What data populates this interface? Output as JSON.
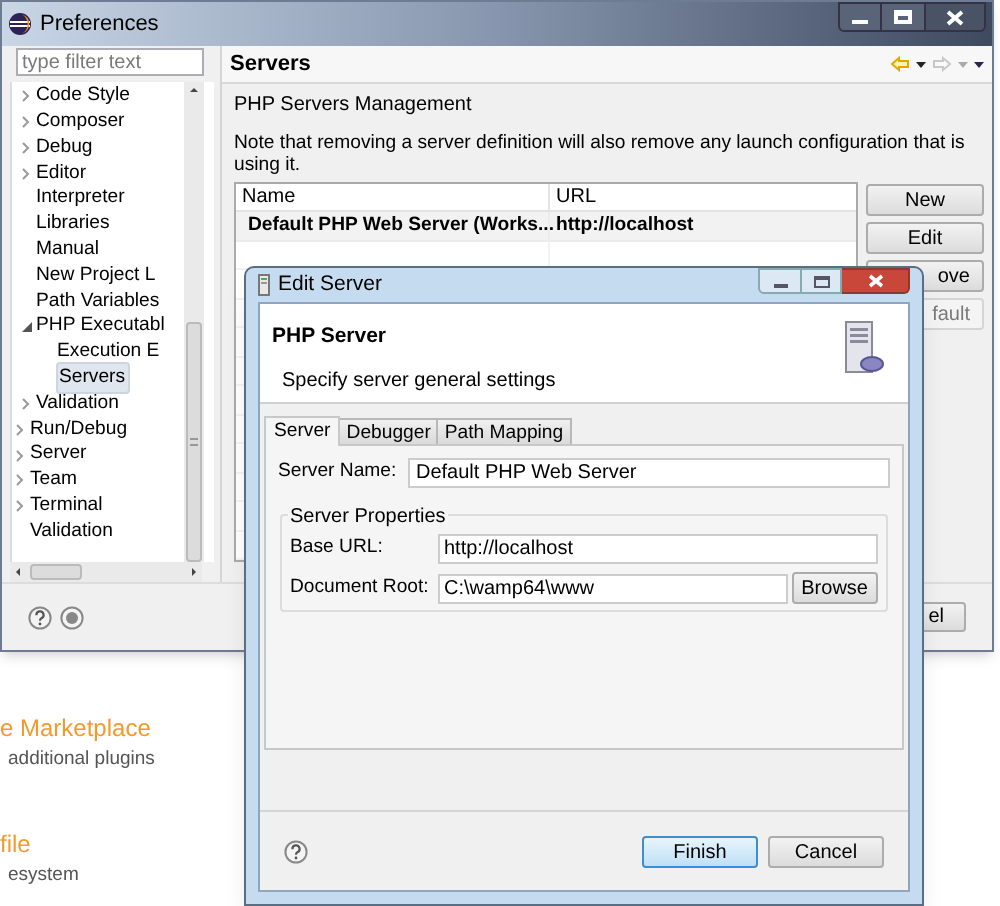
{
  "background": {
    "links": [
      {
        "title": "e Marketplace",
        "subtitle": "additional plugins"
      },
      {
        "title": "file",
        "subtitle": "esystem"
      }
    ]
  },
  "preferences": {
    "title": "Preferences",
    "filter": {
      "placeholder": "type filter text"
    },
    "tree": [
      {
        "children": [
          {
            "label": "Code Style",
            "expanded": false,
            "selected": false
          },
          {
            "label": "Composer",
            "expanded": false,
            "selected": false
          },
          {
            "label": "Debug",
            "expanded": false,
            "selected": false
          },
          {
            "label": "Editor",
            "expanded": false,
            "selected": false
          },
          {
            "label": "Interpreter",
            "selected": false
          },
          {
            "label": "Libraries",
            "selected": false
          },
          {
            "label": "Manual",
            "selected": false
          },
          {
            "label": "New Project L",
            "selected": false
          },
          {
            "label": "Path Variables",
            "selected": false
          },
          {
            "label": "PHP Executabl",
            "expanded": true,
            "selected": false,
            "children": [
              {
                "label": "Execution E",
                "selected": false
              },
              {
                "label": "Servers",
                "selected": true
              }
            ]
          },
          {
            "label": "Validation",
            "expanded": false,
            "selected": false
          }
        ]
      },
      {
        "label": "Run/Debug",
        "expanded": false,
        "selected": false
      },
      {
        "label": "Server",
        "expanded": false,
        "selected": false
      },
      {
        "label": "Team",
        "expanded": false,
        "selected": false
      },
      {
        "label": "Terminal",
        "expanded": false,
        "selected": false
      },
      {
        "label": "Validation",
        "selected": false
      }
    ],
    "page": {
      "title": "Servers",
      "subtitle": "PHP Servers Management",
      "note": "Note that removing a server definition will also remove any launch configuration that is using it.",
      "table": {
        "columns": [
          "Name",
          "URL"
        ],
        "rows": [
          {
            "name": "Default PHP Web Server (Works...",
            "url": "http://localhost"
          }
        ]
      },
      "buttons": [
        {
          "label": "New",
          "disabled": false
        },
        {
          "label": "Edit",
          "disabled": false
        },
        {
          "label": "ove",
          "disabled": false
        },
        {
          "label": "fault",
          "disabled": true
        }
      ]
    },
    "footer_buttons": [
      {
        "label": "el"
      }
    ]
  },
  "dialog": {
    "title": "Edit Server",
    "header": {
      "title": "PHP Server",
      "subtitle": "Specify server general settings"
    },
    "tabs": [
      {
        "label": "Server",
        "selected": true
      },
      {
        "label": "Debugger",
        "selected": false
      },
      {
        "label": "Path Mapping",
        "selected": false
      }
    ],
    "server_name": {
      "label": "Server Name:",
      "value": "Default PHP Web Server"
    },
    "group": {
      "title": "Server Properties",
      "fields": [
        {
          "label": "Base URL:",
          "value": "http://localhost"
        },
        {
          "label": "Document Root:",
          "value": "C:\\wamp64\\www",
          "button": "Browse"
        }
      ]
    },
    "buttons": [
      {
        "label": "Finish",
        "default": true
      },
      {
        "label": "Cancel",
        "default": false
      }
    ]
  }
}
